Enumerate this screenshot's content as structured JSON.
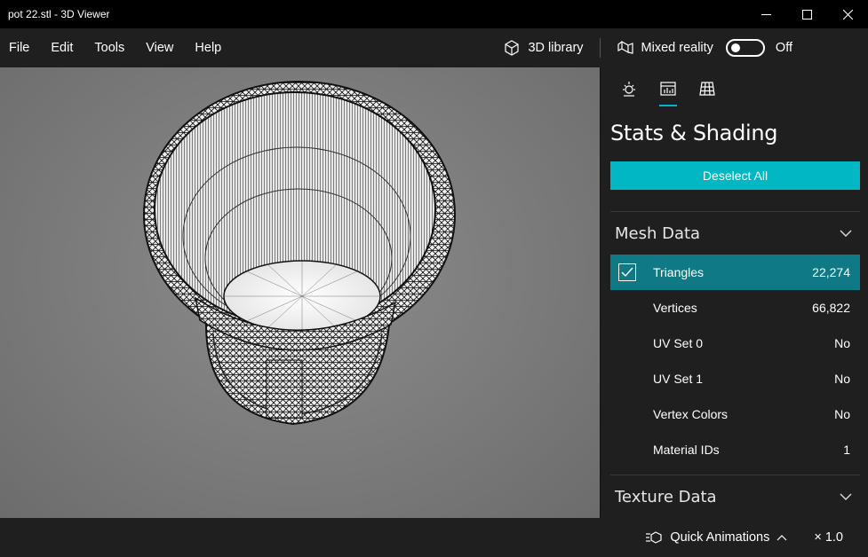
{
  "window": {
    "title": "pot 22.stl - 3D Viewer"
  },
  "menu": {
    "items": [
      "File",
      "Edit",
      "Tools",
      "View",
      "Help"
    ]
  },
  "toolbar": {
    "library_label": "3D library",
    "mixed_reality_label": "Mixed reality",
    "toggle_state": "Off"
  },
  "panel": {
    "tabs": [
      {
        "icon": "lighting-icon",
        "active": false
      },
      {
        "icon": "stats-icon",
        "active": true
      },
      {
        "icon": "grid-icon",
        "active": false
      }
    ],
    "title": "Stats & Shading",
    "deselect_label": "Deselect All",
    "mesh_section": "Mesh Data",
    "mesh_rows": [
      {
        "name": "Triangles",
        "value": "22,274",
        "checked": true
      },
      {
        "name": "Vertices",
        "value": "66,822"
      },
      {
        "name": "UV Set 0",
        "value": "No"
      },
      {
        "name": "UV Set 1",
        "value": "No"
      },
      {
        "name": "Vertex Colors",
        "value": "No"
      },
      {
        "name": "Material IDs",
        "value": "1"
      }
    ],
    "texture_section": "Texture Data"
  },
  "status": {
    "quick_animations": "Quick Animations",
    "speed": "× 1.0"
  },
  "colors": {
    "accent": "#00b7c3",
    "selected_row": "#0f7a85",
    "background": "#1f1f1f",
    "titlebar": "#000000"
  }
}
